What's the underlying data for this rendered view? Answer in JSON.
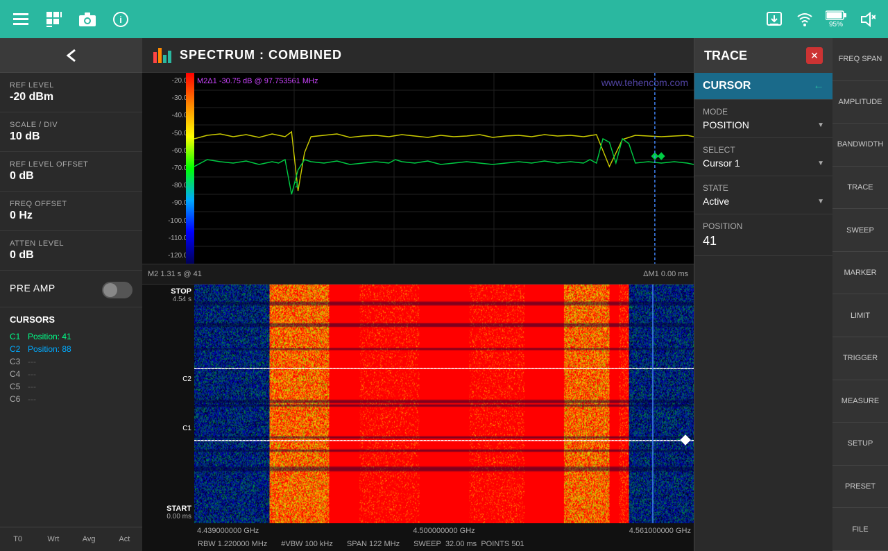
{
  "topbar": {
    "icons": [
      "menu",
      "grid",
      "camera",
      "info"
    ],
    "right_icons": [
      "download",
      "wifi",
      "battery",
      "mute"
    ],
    "battery_percent": "95%"
  },
  "left_panel": {
    "ref_level_label": "REF LEVEL",
    "ref_level_value": "-20 dBm",
    "scale_div_label": "SCALE / DIV",
    "scale_div_value": "10 dB",
    "ref_level_offset_label": "REF LEVEL OFFSET",
    "ref_level_offset_value": "0 dB",
    "freq_offset_label": "FREQ OFFSET",
    "freq_offset_value": "0 Hz",
    "atten_level_label": "ATTEN LEVEL",
    "atten_level_value": "0 dB",
    "pre_amp_label": "PRE AMP",
    "cursors_label": "CURSORS",
    "cursors": [
      {
        "id": "C1",
        "position": "Position: 41",
        "active": true,
        "color": "green"
      },
      {
        "id": "C2",
        "position": "Position: 88",
        "active": true,
        "color": "blue"
      },
      {
        "id": "C3",
        "position": "---",
        "active": false
      },
      {
        "id": "C4",
        "position": "---",
        "active": false
      },
      {
        "id": "C5",
        "position": "---",
        "active": false
      },
      {
        "id": "C6",
        "position": "---",
        "active": false
      }
    ],
    "bottom_tabs": [
      "T0",
      "Wrt",
      "Avg",
      "Act"
    ]
  },
  "spectrum": {
    "title": "SPECTRUM : COMBINED",
    "marker_label": "M2Δ1",
    "marker_value": "-30.75 dB @ 97.753561 MHz",
    "watermark": "www.tehencom.com",
    "y_axis": [
      "-20.00",
      "-30.00",
      "-40.00",
      "-50.00",
      "-60.00",
      "-70.00",
      "-80.00",
      "-90.00",
      "-100.00",
      "-110.00",
      "-120.00"
    ],
    "m2_label": "M2 1.31 s @ 41",
    "delta_m1_label": "ΔM1 0.00 ms",
    "stop_label": "STOP",
    "stop_value": "4.54 s",
    "start_label": "START",
    "start_value": "0.00 ms",
    "cursor_c2_label": "C2",
    "cursor_c1_label": "C1",
    "freq_labels": [
      "4.439000000 GHz",
      "4.500000000 GHz",
      "4.561000000 GHz"
    ],
    "rbw_label": "RBW 1.220000 MHz",
    "vbw_label": "#VBW 100 kHz",
    "span_label": "SPAN 122 MHz",
    "sweep_label": "SWEEP",
    "sweep_value": "32.00 ms",
    "points_label": "POINTS 501"
  },
  "trace_panel": {
    "title": "TRACE",
    "cursor_section_label": "CURSOR",
    "mode_label": "MODE",
    "mode_value": "POSITION",
    "select_label": "SELECT",
    "select_value": "Cursor 1",
    "state_label": "STATE",
    "state_value": "Active",
    "position_label": "POSITION",
    "position_value": "41"
  },
  "nav_items": [
    "FREQ SPAN",
    "AMPLITUDE",
    "BANDWIDTH",
    "TRACE",
    "SWEEP",
    "MARKER",
    "LIMIT",
    "TRIGGER",
    "MEASURE",
    "SETUP",
    "PRESET",
    "FILE"
  ]
}
